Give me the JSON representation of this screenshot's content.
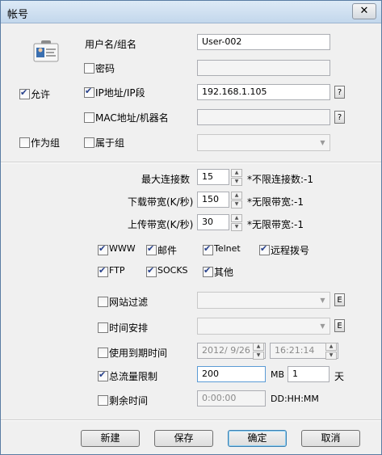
{
  "window": {
    "title": "帐号",
    "close_glyph": "✕"
  },
  "account": {
    "username_label": "用户名/组名",
    "username_value": "User-002",
    "password_label": "密码",
    "password_checked": false,
    "allow_label": "允许",
    "allow_checked": true,
    "ip_label": "IP地址/IP段",
    "ip_checked": true,
    "ip_value": "192.168.1.105",
    "ip_help": "?",
    "mac_label": "MAC地址/机器名",
    "mac_checked": false,
    "mac_help": "?",
    "group_label": "作为组",
    "group_checked": false,
    "member_label": "属于组",
    "member_checked": false
  },
  "limits": {
    "max_conn_label": "最大连接数",
    "max_conn_value": "15",
    "max_conn_hint": "*不限连接数:-1",
    "download_label": "下载带宽(K/秒)",
    "download_value": "150",
    "download_hint": "*无限带宽:-1",
    "upload_label": "上传带宽(K/秒)",
    "upload_value": "30",
    "upload_hint": "*无限带宽:-1"
  },
  "protocols": [
    {
      "label": "WWW",
      "checked": true
    },
    {
      "label": "邮件",
      "checked": true
    },
    {
      "label": "Telnet",
      "checked": true
    },
    {
      "label": "远程拨号",
      "checked": true
    },
    {
      "label": "FTP",
      "checked": true
    },
    {
      "label": "SOCKS",
      "checked": true
    },
    {
      "label": "其他",
      "checked": true
    }
  ],
  "options": {
    "web_filter_label": "网站过滤",
    "web_filter_checked": false,
    "web_filter_edit": "E",
    "schedule_label": "时间安排",
    "schedule_checked": false,
    "schedule_edit": "E",
    "expire_label": "使用到期时间",
    "expire_checked": false,
    "expire_date": "2012/ 9/26",
    "expire_time": "16:21:14",
    "quota_label": "总流量限制",
    "quota_checked": true,
    "quota_value": "200",
    "quota_unit": "MB",
    "quota_days": "1",
    "quota_days_unit": "天",
    "remain_label": "剩余时间",
    "remain_checked": false,
    "remain_value": "0:00:00",
    "remain_format": "DD:HH:MM"
  },
  "buttons": {
    "new": "新建",
    "save": "保存",
    "ok": "确定",
    "cancel": "取消"
  }
}
